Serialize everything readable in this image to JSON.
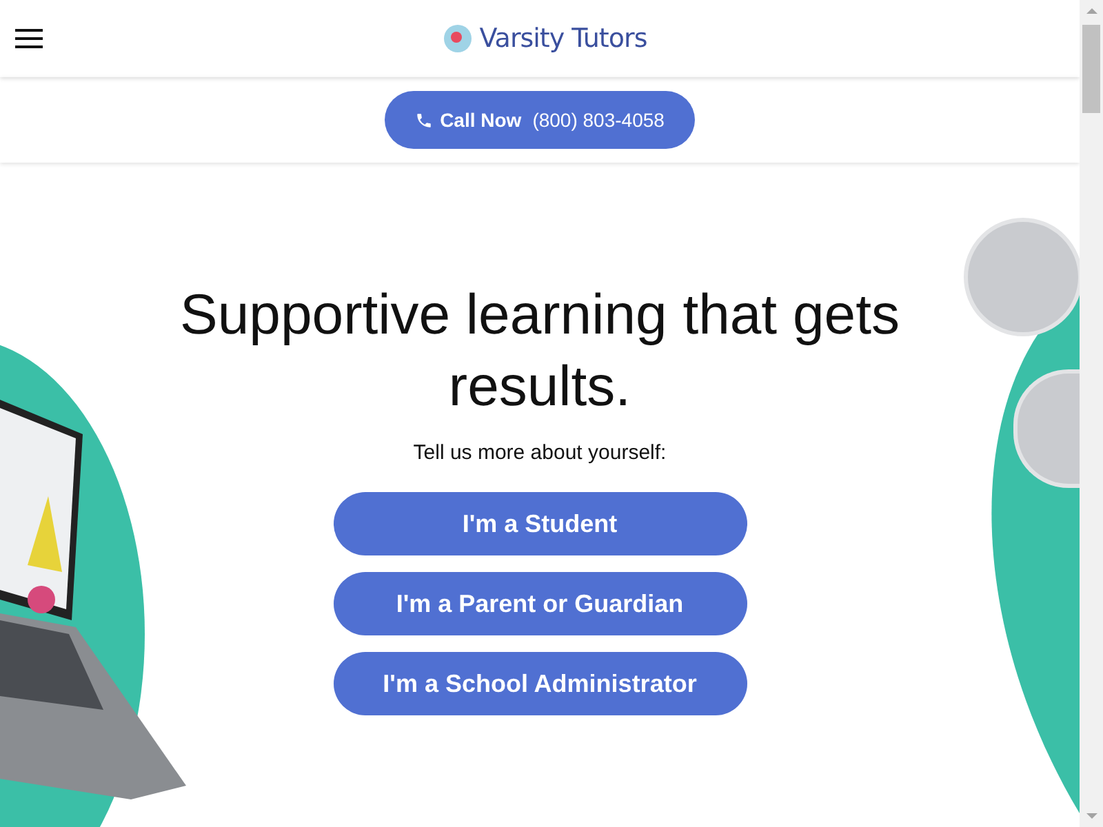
{
  "header": {
    "brand": "Varsity Tutors"
  },
  "call_bar": {
    "label": "Call Now",
    "phone": "(800) 803-4058"
  },
  "hero": {
    "headline": "Supportive learning that gets results.",
    "prompt": "Tell us more about yourself:",
    "options": [
      {
        "label": "I'm a Student"
      },
      {
        "label": "I'm a Parent or Guardian"
      },
      {
        "label": "I'm a School Administrator"
      }
    ]
  }
}
